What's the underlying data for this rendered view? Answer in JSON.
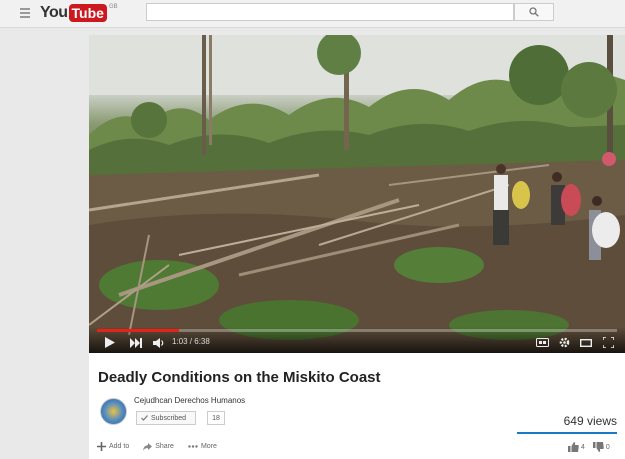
{
  "masthead": {
    "logo_you": "You",
    "logo_tube": "Tube",
    "logo_country": "GB",
    "search_placeholder": ""
  },
  "player": {
    "time_display": "1:03 / 6:38",
    "progress_fraction": 0.158,
    "accent": "#e62117"
  },
  "video": {
    "title": "Deadly Conditions on the Miskito Coast",
    "channel_name": "Cejudhcan Derechos Humanos",
    "subscribe_label": "Subscribed",
    "subscriber_count": "18",
    "views": "649 views"
  },
  "actions": {
    "add_to": "Add to",
    "share": "Share",
    "more": "More",
    "likes": "4",
    "dislikes": "0"
  }
}
